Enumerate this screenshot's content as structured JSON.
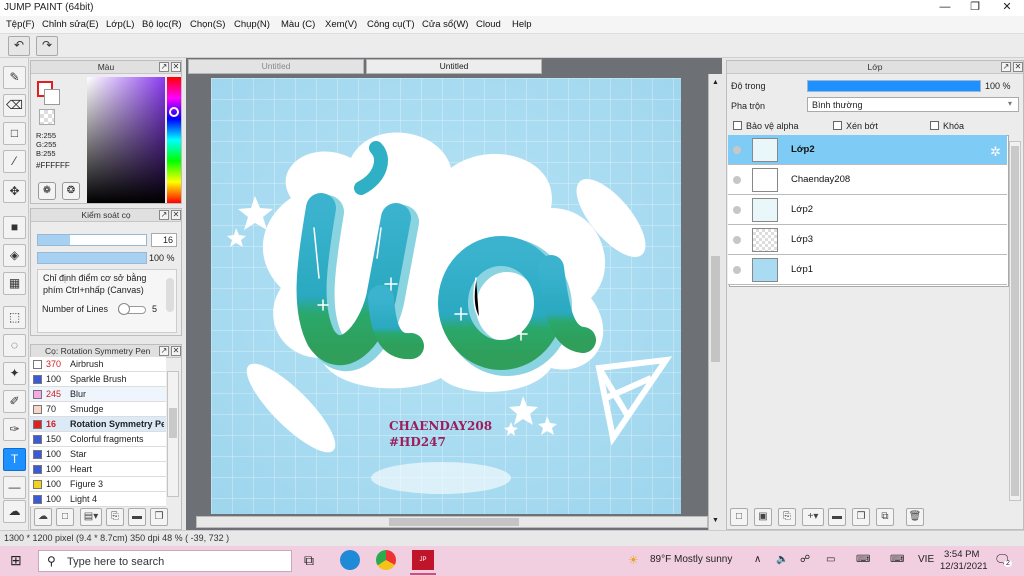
{
  "window": {
    "title": "JUMP PAINT (64bit)",
    "minimize": "—",
    "maximize": "❐",
    "close": "✕"
  },
  "menu": [
    "Tệp(F)",
    "Chỉnh sửa(E)",
    "Lớp(L)",
    "Bộ lọc(R)",
    "Chọn(S)",
    "Chụp(N)",
    "Màu (C)",
    "Xem(V)",
    "Công cụ(T)",
    "Cửa sổ(W)",
    "Cloud",
    "Help"
  ],
  "toolbar": {
    "undo": "↶",
    "redo": "↷"
  },
  "color_panel": {
    "title": "Màu",
    "r": "R:255",
    "g": "G:255",
    "b": "B:255",
    "hex": "#FFFFFF"
  },
  "brush_control": {
    "title": "Kiểm soát cọ",
    "size": "16",
    "opacity": "100 %",
    "size_fraction": 0.3,
    "opacity_fraction": 1.0,
    "hint": "Chỉ định điểm cơ sở bằng phím Ctrl+nhấp (Canvas)",
    "lines_label": "Number of Lines",
    "lines_value": "5"
  },
  "brush_list": {
    "title": "Cọ: Rotation Symmetry Pen",
    "items": [
      {
        "size": "370",
        "name": "Airbrush",
        "color": "#ffffff",
        "size_color": "#d02020"
      },
      {
        "size": "100",
        "name": "Sparkle Brush",
        "color": "#3a5bd9",
        "size_color": "#222222"
      },
      {
        "size": "245",
        "name": "Blur",
        "color": "#f7a8e6",
        "size_color": "#d02020"
      },
      {
        "size": "70",
        "name": "Smudge",
        "color": "#f6d6c6",
        "size_color": "#222222"
      },
      {
        "size": "16",
        "name": "Rotation Symmetry Pen",
        "color": "#e02020",
        "size_color": "#d02020"
      },
      {
        "size": "150",
        "name": "Colorful fragments",
        "color": "#3a5bd9",
        "size_color": "#222222"
      },
      {
        "size": "100",
        "name": "Star",
        "color": "#3a5bd9",
        "size_color": "#222222"
      },
      {
        "size": "100",
        "name": "Heart",
        "color": "#3a5bd9",
        "size_color": "#222222"
      },
      {
        "size": "100",
        "name": "Figure 3",
        "color": "#f2d21a",
        "size_color": "#222222"
      },
      {
        "size": "100",
        "name": "Light 4",
        "color": "#3a5bd9",
        "size_color": "#222222"
      }
    ]
  },
  "tabs": [
    {
      "label": "Untitled"
    },
    {
      "label": "Untitled"
    }
  ],
  "canvas": {
    "lettering": "ủa",
    "signature_line1": "CHAENDAY208",
    "signature_line2": "#HD247"
  },
  "layers_panel": {
    "title": "Lớp",
    "opacity_label": "Độ trong",
    "opacity_value": "100 %",
    "blend_label": "Pha trộn",
    "blend_value": "Bình thường",
    "protect_alpha": "Bảo vệ alpha",
    "clipping": "Xén bớt",
    "lock": "Khóa",
    "layers": [
      {
        "name": "Lớp2",
        "selected": true
      },
      {
        "name": "Chaenday208",
        "selected": false
      },
      {
        "name": "Lớp2",
        "selected": false
      },
      {
        "name": "Lớp3",
        "selected": false
      },
      {
        "name": "Lớp1",
        "selected": false
      }
    ]
  },
  "status": {
    "text": "1300 * 1200 pixel   (9.4 * 8.7cm)   350 dpi   48 %   ( -39, 732 )"
  },
  "taskbar": {
    "search_placeholder": "Type here to search",
    "weather": "89°F  Mostly sunny",
    "lang": "VIE",
    "time": "3:54 PM",
    "date": "12/31/2021",
    "notif": "2"
  },
  "colors": {
    "accent": "#1e90ff",
    "layer_selected": "#7ecbf5",
    "taskbar": "#f1cfe0",
    "canvas_sky": "#a9dbf2",
    "letter_teal": "#2fb0c4",
    "letter_green": "#2aa86a",
    "signature": "#9b1d5c"
  }
}
